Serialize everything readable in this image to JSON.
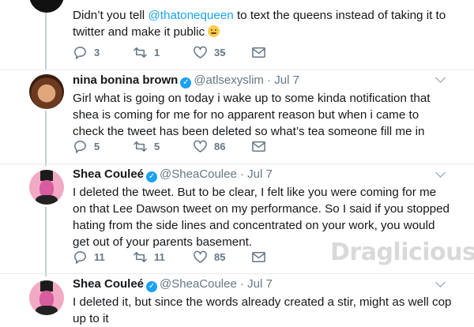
{
  "tweets": [
    {
      "text_parts": [
        "Didn’t you tell ",
        "@thatonequeen",
        " to text the queens instead of taking it to twitter and make it public"
      ],
      "replies": "3",
      "retweets": "1",
      "likes": "35"
    },
    {
      "name": "nina bonina brown",
      "handle": "@atlsexyslim",
      "dot": "·",
      "date": "Jul 7",
      "text": "Girl what is going on today i wake up to some kinda notification that shea is coming for me for no apparent reason but when i came to check the tweet has been deleted so what’s tea someone fill me in",
      "replies": "5",
      "retweets": "5",
      "likes": "86"
    },
    {
      "name": "Shea Couleé",
      "handle": "@SheaCoulee",
      "dot": "·",
      "date": "Jul 7",
      "text": "I deleted the tweet. But to be clear, I felt like you were coming for me on that Lee Dawson tweet on my performance. So I said if you stopped hating from the side lines and concentrated on your work, you would get out of your parents basement.",
      "replies": "11",
      "retweets": "11",
      "likes": "85"
    },
    {
      "name": "Shea Couleé",
      "handle": "@SheaCoulee",
      "dot": "·",
      "date": "Jul 7",
      "text": "I deleted it, but since the words already created a stir, might as well cop up to it"
    }
  ],
  "watermark": "Draglicious",
  "colors": {
    "link": "#1da1f2",
    "muted": "#657786",
    "thread": "#c4cfd6"
  },
  "icons": [
    "reply-icon",
    "retweet-icon",
    "like-icon",
    "message-icon",
    "verified-badge-icon",
    "chevron-down-icon",
    "thinking-face-emoji"
  ]
}
